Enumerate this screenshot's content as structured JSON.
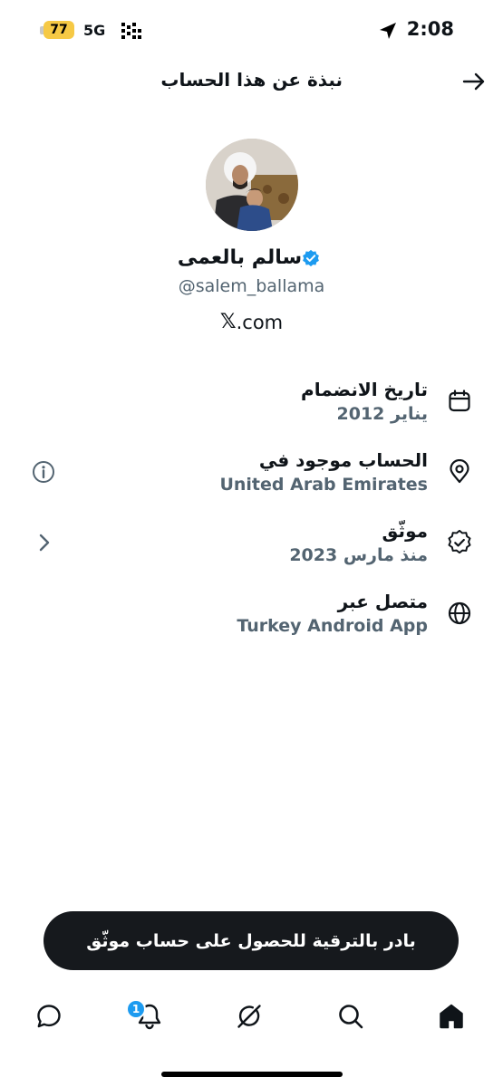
{
  "status_bar": {
    "battery": "77",
    "network": "5G",
    "time": "2:08"
  },
  "header": {
    "title": "نبذة عن هذا الحساب",
    "back_icon": "arrow-right-icon"
  },
  "profile": {
    "display_name": "سالم بالعمى",
    "handle": "@salem_ballama",
    "site_suffix": ".com",
    "site_logo": "𝕏",
    "verified_color": "#1d9bf0"
  },
  "info": [
    {
      "label": "تاريخ الانضمام",
      "value": "يناير 2012",
      "icon": "calendar-icon"
    },
    {
      "label": "الحساب موجود في",
      "value": "United Arab Emirates",
      "icon": "location-pin-icon",
      "aux_icon": "info-icon"
    },
    {
      "label": "موثّق",
      "value": "منذ مارس 2023",
      "icon": "verified-seal-icon",
      "aux_icon": "chevron-right-icon"
    },
    {
      "label": "متصل عبر",
      "value": "Turkey Android App",
      "icon": "globe-icon"
    }
  ],
  "cta": {
    "label": "بادر بالترقية للحصول على حساب موثّق"
  },
  "nav": {
    "items": [
      "messages-icon",
      "notifications-icon",
      "grok-icon",
      "search-icon",
      "home-icon"
    ],
    "notification_count": "1"
  }
}
